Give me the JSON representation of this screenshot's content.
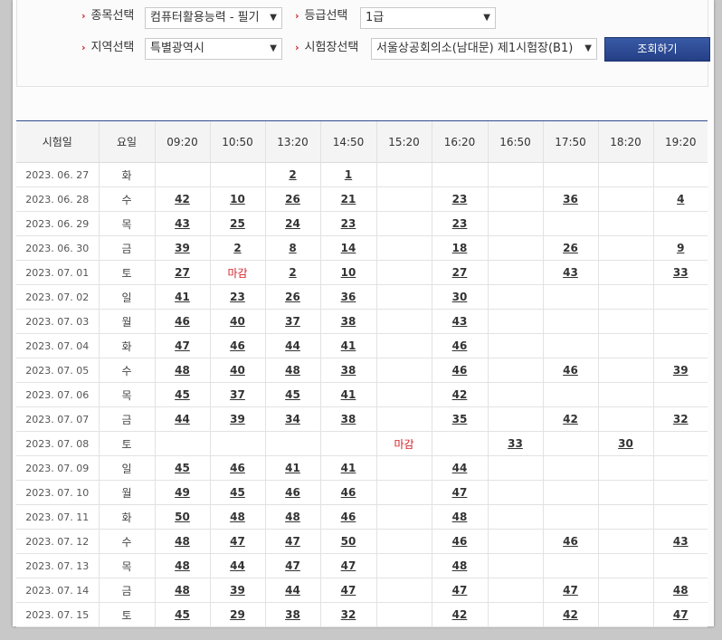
{
  "filters": {
    "subject_label": "종목선택",
    "subject_value": "컴퓨터활용능력 - 필기",
    "grade_label": "등급선택",
    "grade_value": "1급",
    "region_label": "지역선택",
    "region_value": "특별광역시",
    "venue_label": "시험장선택",
    "venue_value": "서울상공회의소(남대문) 제1시험장(B1)",
    "search_button": "조회하기"
  },
  "table": {
    "headers": [
      "시험일",
      "요일",
      "09:20",
      "10:50",
      "13:20",
      "14:50",
      "15:20",
      "16:20",
      "16:50",
      "17:50",
      "18:20",
      "19:20"
    ],
    "closed_text": "마감",
    "rows": [
      {
        "date": "2023. 06. 27",
        "dow": "화",
        "cells": [
          "",
          "",
          "2",
          "1",
          "",
          "",
          "",
          "",
          "",
          ""
        ]
      },
      {
        "date": "2023. 06. 28",
        "dow": "수",
        "cells": [
          "42",
          "10",
          "26",
          "21",
          "",
          "23",
          "",
          "36",
          "",
          "4"
        ]
      },
      {
        "date": "2023. 06. 29",
        "dow": "목",
        "cells": [
          "43",
          "25",
          "24",
          "23",
          "",
          "23",
          "",
          "",
          "",
          ""
        ]
      },
      {
        "date": "2023. 06. 30",
        "dow": "금",
        "cells": [
          "39",
          "2",
          "8",
          "14",
          "",
          "18",
          "",
          "26",
          "",
          "9"
        ]
      },
      {
        "date": "2023. 07. 01",
        "dow": "토",
        "cells": [
          "27",
          "마감",
          "2",
          "10",
          "",
          "27",
          "",
          "43",
          "",
          "33"
        ]
      },
      {
        "date": "2023. 07. 02",
        "dow": "일",
        "cells": [
          "41",
          "23",
          "26",
          "36",
          "",
          "30",
          "",
          "",
          "",
          ""
        ]
      },
      {
        "date": "2023. 07. 03",
        "dow": "월",
        "cells": [
          "46",
          "40",
          "37",
          "38",
          "",
          "43",
          "",
          "",
          "",
          ""
        ]
      },
      {
        "date": "2023. 07. 04",
        "dow": "화",
        "cells": [
          "47",
          "46",
          "44",
          "41",
          "",
          "46",
          "",
          "",
          "",
          ""
        ]
      },
      {
        "date": "2023. 07. 05",
        "dow": "수",
        "cells": [
          "48",
          "40",
          "48",
          "38",
          "",
          "46",
          "",
          "46",
          "",
          "39"
        ]
      },
      {
        "date": "2023. 07. 06",
        "dow": "목",
        "cells": [
          "45",
          "37",
          "45",
          "41",
          "",
          "42",
          "",
          "",
          "",
          ""
        ]
      },
      {
        "date": "2023. 07. 07",
        "dow": "금",
        "cells": [
          "44",
          "39",
          "34",
          "38",
          "",
          "35",
          "",
          "42",
          "",
          "32"
        ]
      },
      {
        "date": "2023. 07. 08",
        "dow": "토",
        "cells": [
          "",
          "",
          "",
          "",
          "마감",
          "",
          "33",
          "",
          "30",
          ""
        ]
      },
      {
        "date": "2023. 07. 09",
        "dow": "일",
        "cells": [
          "45",
          "46",
          "41",
          "41",
          "",
          "44",
          "",
          "",
          "",
          ""
        ]
      },
      {
        "date": "2023. 07. 10",
        "dow": "월",
        "cells": [
          "49",
          "45",
          "46",
          "46",
          "",
          "47",
          "",
          "",
          "",
          ""
        ]
      },
      {
        "date": "2023. 07. 11",
        "dow": "화",
        "cells": [
          "50",
          "48",
          "48",
          "46",
          "",
          "48",
          "",
          "",
          "",
          ""
        ]
      },
      {
        "date": "2023. 07. 12",
        "dow": "수",
        "cells": [
          "48",
          "47",
          "47",
          "50",
          "",
          "46",
          "",
          "46",
          "",
          "43"
        ]
      },
      {
        "date": "2023. 07. 13",
        "dow": "목",
        "cells": [
          "48",
          "44",
          "47",
          "47",
          "",
          "48",
          "",
          "",
          "",
          ""
        ]
      },
      {
        "date": "2023. 07. 14",
        "dow": "금",
        "cells": [
          "48",
          "39",
          "44",
          "47",
          "",
          "47",
          "",
          "47",
          "",
          "48"
        ]
      },
      {
        "date": "2023. 07. 15",
        "dow": "토",
        "cells": [
          "45",
          "29",
          "38",
          "32",
          "",
          "42",
          "",
          "42",
          "",
          "47"
        ]
      }
    ]
  }
}
